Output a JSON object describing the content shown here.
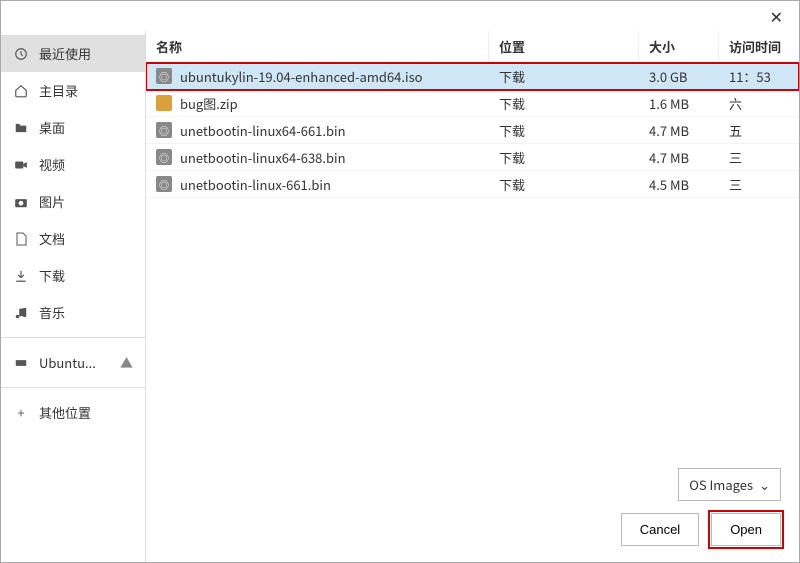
{
  "sidebar": {
    "items": [
      {
        "label": "最近使用",
        "icon": "clock"
      },
      {
        "label": "主目录",
        "icon": "home"
      },
      {
        "label": "桌面",
        "icon": "folder"
      },
      {
        "label": "视频",
        "icon": "video"
      },
      {
        "label": "图片",
        "icon": "camera"
      },
      {
        "label": "文档",
        "icon": "doc"
      },
      {
        "label": "下载",
        "icon": "download"
      },
      {
        "label": "音乐",
        "icon": "music"
      }
    ],
    "volume": {
      "label": "Ubuntu...",
      "icon": "disk"
    },
    "other": {
      "label": "其他位置",
      "icon": "plus"
    }
  },
  "columns": {
    "name": "名称",
    "location": "位置",
    "size": "大小",
    "time": "访问时间"
  },
  "files": [
    {
      "name": "ubuntukylin-19.04-enhanced-amd64.iso",
      "location": "下载",
      "size": "3.0 GB",
      "time": "11：53",
      "icon": "iso",
      "selected": true
    },
    {
      "name": "bug图.zip",
      "location": "下载",
      "size": "1.6 MB",
      "time": "六",
      "icon": "zip"
    },
    {
      "name": "unetbootin-linux64-661.bin",
      "location": "下载",
      "size": "4.7 MB",
      "time": "五",
      "icon": "bin"
    },
    {
      "name": "unetbootin-linux64-638.bin",
      "location": "下载",
      "size": "4.7 MB",
      "time": "三",
      "icon": "bin"
    },
    {
      "name": "unetbootin-linux-661.bin",
      "location": "下载",
      "size": "4.5 MB",
      "time": "三",
      "icon": "bin"
    }
  ],
  "filter": {
    "label": "OS Images"
  },
  "buttons": {
    "cancel": "Cancel",
    "open": "Open"
  }
}
